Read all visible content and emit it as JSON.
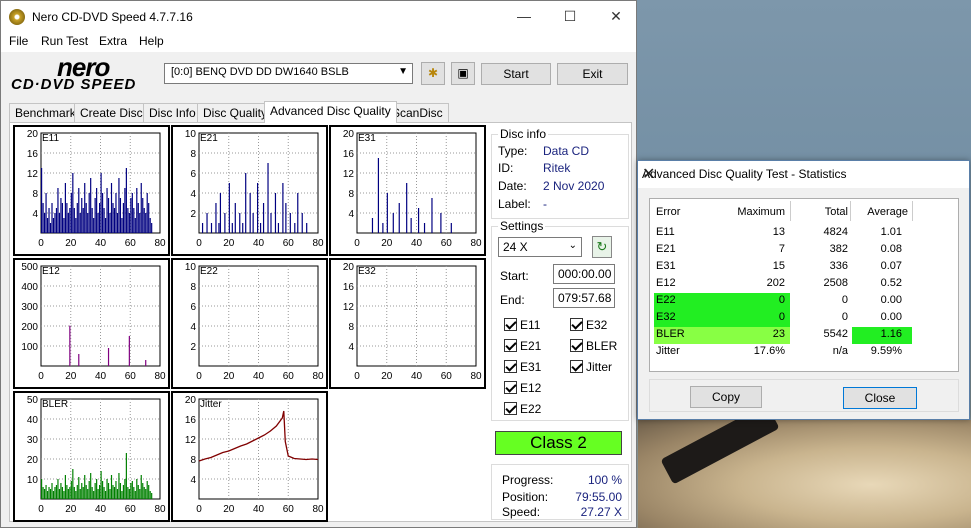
{
  "app": {
    "title": "Nero CD-DVD Speed 4.7.7.16",
    "logo_top": "nero",
    "logo_bottom": "CD·DVD SPEED"
  },
  "window_controls": {
    "minimize": "—",
    "maximize": "☐",
    "close": "✕"
  },
  "menu": [
    "File",
    "Run Test",
    "Extra",
    "Help"
  ],
  "toolbar": {
    "drive": "[0:0]   BENQ DVD DD DW1640 BSLB",
    "start": "Start",
    "exit": "Exit"
  },
  "tabs": [
    "Benchmark",
    "Create Disc",
    "Disc Info",
    "Disc Quality",
    "Advanced Disc Quality",
    "ScanDisc"
  ],
  "active_tab": 4,
  "disc_info": {
    "title": "Disc info",
    "type_label": "Type:",
    "type": "Data CD",
    "id_label": "ID:",
    "id": "Ritek",
    "date_label": "Date:",
    "date": "2 Nov 2020",
    "label_label": "Label:",
    "label": "-"
  },
  "settings": {
    "title": "Settings",
    "speed": "24 X",
    "start_label": "Start:",
    "start": "000:00.00",
    "end_label": "End:",
    "end": "079:57.68"
  },
  "checkboxes": [
    "E11",
    "E32",
    "E21",
    "BLER",
    "E31",
    "Jitter",
    "E12",
    "E22"
  ],
  "class_label": "Class 2",
  "status": {
    "progress_label": "Progress:",
    "progress": "100 %",
    "position_label": "Position:",
    "position": "79:55.00",
    "speed_label": "Speed:",
    "speed": "27.27 X"
  },
  "colors": {
    "series_main": "#000080",
    "bler": "#008000",
    "jitter": "#800000",
    "class_bg": "#66ff22",
    "highlight_green": "#22ee22",
    "highlight_light": "#88ff44"
  },
  "chart_data": [
    {
      "type": "bar",
      "title": "E11",
      "x": [
        0,
        20,
        40,
        60,
        80
      ],
      "ylim": [
        0,
        20
      ],
      "yticks": [
        4,
        8,
        12,
        16,
        20
      ],
      "color": "#000080",
      "values": [
        13,
        6,
        4,
        8,
        3,
        5,
        2,
        6,
        3,
        4,
        5,
        9,
        4,
        7,
        6,
        3,
        10,
        6,
        4,
        5,
        8,
        12,
        5,
        3,
        6,
        9,
        4,
        7,
        5,
        10,
        6,
        4,
        8,
        11,
        5,
        3,
        7,
        9,
        4,
        6,
        12,
        8,
        5,
        3,
        9,
        7,
        4,
        10,
        6,
        5,
        8,
        4,
        11,
        7,
        3,
        6,
        9,
        13,
        5,
        4,
        7,
        8,
        5,
        3,
        9,
        6,
        4,
        10,
        7,
        5,
        4,
        8,
        6,
        3,
        2,
        0,
        0,
        0,
        0,
        0
      ]
    },
    {
      "type": "bar",
      "title": "E21",
      "x": [
        0,
        20,
        40,
        60,
        80
      ],
      "ylim": [
        0,
        10
      ],
      "yticks": [
        2,
        4,
        6,
        8,
        10
      ],
      "color": "#000080",
      "values": [
        0,
        0,
        1,
        0,
        0,
        2,
        0,
        0,
        1,
        0,
        0,
        3,
        0,
        1,
        4,
        0,
        0,
        2,
        0,
        0,
        5,
        0,
        1,
        0,
        3,
        0,
        0,
        2,
        0,
        1,
        0,
        6,
        0,
        0,
        4,
        0,
        2,
        0,
        0,
        5,
        0,
        1,
        0,
        3,
        0,
        0,
        7,
        0,
        2,
        0,
        0,
        4,
        0,
        1,
        0,
        0,
        5,
        0,
        3,
        0,
        0,
        2,
        0,
        0,
        1,
        0,
        4,
        0,
        0,
        2,
        0,
        0,
        1,
        0,
        0,
        0,
        0,
        0,
        0,
        0
      ]
    },
    {
      "type": "bar",
      "title": "E31",
      "x": [
        0,
        20,
        40,
        60,
        80
      ],
      "ylim": [
        0,
        20
      ],
      "yticks": [
        4,
        8,
        12,
        16,
        20
      ],
      "color": "#000080",
      "values": [
        0,
        0,
        0,
        0,
        0,
        0,
        0,
        0,
        0,
        0,
        3,
        0,
        0,
        0,
        15,
        0,
        0,
        2,
        0,
        0,
        8,
        0,
        0,
        0,
        4,
        0,
        0,
        0,
        6,
        0,
        0,
        0,
        0,
        10,
        0,
        0,
        3,
        0,
        0,
        0,
        0,
        5,
        0,
        0,
        0,
        2,
        0,
        0,
        0,
        0,
        7,
        0,
        0,
        0,
        0,
        0,
        4,
        0,
        0,
        0,
        0,
        0,
        0,
        2,
        0,
        0,
        0,
        0,
        0,
        0,
        0,
        0,
        0,
        0,
        0,
        0,
        0,
        0,
        0,
        0
      ]
    },
    {
      "type": "bar",
      "title": "E12",
      "x": [
        0,
        20,
        40,
        60,
        80
      ],
      "ylim": [
        0,
        500
      ],
      "yticks": [
        100,
        200,
        300,
        400,
        500
      ],
      "color": "#800080",
      "values": [
        0,
        0,
        0,
        0,
        0,
        0,
        0,
        0,
        0,
        0,
        0,
        0,
        0,
        0,
        0,
        0,
        0,
        0,
        0,
        202,
        0,
        0,
        0,
        0,
        0,
        60,
        0,
        0,
        0,
        0,
        0,
        0,
        0,
        0,
        0,
        0,
        0,
        0,
        0,
        0,
        0,
        0,
        0,
        0,
        0,
        90,
        0,
        0,
        0,
        0,
        0,
        0,
        0,
        0,
        0,
        0,
        0,
        0,
        0,
        150,
        0,
        0,
        0,
        0,
        0,
        0,
        0,
        0,
        0,
        0,
        30,
        0,
        0,
        0,
        0,
        0,
        0,
        0,
        0,
        0
      ]
    },
    {
      "type": "bar",
      "title": "E22",
      "x": [
        0,
        20,
        40,
        60,
        80
      ],
      "ylim": [
        0,
        10
      ],
      "yticks": [
        2,
        4,
        6,
        8,
        10
      ],
      "color": "#000080",
      "values": []
    },
    {
      "type": "bar",
      "title": "E32",
      "x": [
        0,
        20,
        40,
        60,
        80
      ],
      "ylim": [
        0,
        20
      ],
      "yticks": [
        4,
        8,
        12,
        16,
        20
      ],
      "color": "#000080",
      "values": []
    },
    {
      "type": "bar",
      "title": "BLER",
      "x": [
        0,
        20,
        40,
        60,
        80
      ],
      "ylim": [
        0,
        50
      ],
      "yticks": [
        10,
        20,
        30,
        40,
        50
      ],
      "color": "#008000",
      "values": [
        10,
        6,
        5,
        7,
        4,
        6,
        5,
        8,
        4,
        6,
        7,
        10,
        5,
        8,
        6,
        4,
        12,
        7,
        5,
        6,
        9,
        15,
        6,
        4,
        7,
        11,
        5,
        8,
        6,
        12,
        7,
        5,
        9,
        13,
        6,
        4,
        8,
        10,
        5,
        7,
        14,
        9,
        6,
        4,
        10,
        8,
        5,
        12,
        7,
        6,
        9,
        5,
        13,
        8,
        4,
        7,
        10,
        23,
        6,
        5,
        8,
        9,
        6,
        4,
        10,
        7,
        5,
        12,
        8,
        6,
        5,
        9,
        7,
        4,
        3,
        0,
        0,
        0,
        0,
        0
      ]
    },
    {
      "type": "line",
      "title": "Jitter",
      "x": [
        0,
        20,
        40,
        60,
        80
      ],
      "ylim": [
        0,
        20
      ],
      "yticks": [
        4,
        8,
        12,
        16,
        20
      ],
      "color": "#800000",
      "values": [
        [
          0,
          7.6
        ],
        [
          4,
          8.0
        ],
        [
          8,
          8.3
        ],
        [
          12,
          8.8
        ],
        [
          16,
          9.3
        ],
        [
          20,
          9.6
        ],
        [
          24,
          10.1
        ],
        [
          28,
          10.6
        ],
        [
          32,
          11.0
        ],
        [
          36,
          11.6
        ],
        [
          40,
          12.2
        ],
        [
          44,
          12.8
        ],
        [
          48,
          13.6
        ],
        [
          52,
          14.6
        ],
        [
          56,
          16.2
        ],
        [
          57,
          17.6
        ],
        [
          58,
          11.5
        ],
        [
          60,
          8.6
        ],
        [
          64,
          8.1
        ],
        [
          68,
          8.0
        ],
        [
          72,
          7.9
        ],
        [
          76,
          8.0
        ],
        [
          80,
          7.9
        ]
      ]
    }
  ],
  "stats": {
    "title": "Advanced Disc Quality Test - Statistics",
    "headers": [
      "Error",
      "Maximum",
      "Total",
      "Average"
    ],
    "rows": [
      [
        "E11",
        "13",
        "4824",
        "1.01"
      ],
      [
        "E21",
        "7",
        "382",
        "0.08"
      ],
      [
        "E31",
        "15",
        "336",
        "0.07"
      ],
      [
        "E12",
        "202",
        "2508",
        "0.52"
      ],
      [
        "E22",
        "0",
        "0",
        "0.00"
      ],
      [
        "E32",
        "0",
        "0",
        "0.00"
      ],
      [
        "BLER",
        "23",
        "5542",
        "1.16"
      ],
      [
        "Jitter",
        "17.6%",
        "n/a",
        "9.59%"
      ]
    ],
    "copy": "Copy",
    "close": "Close"
  }
}
